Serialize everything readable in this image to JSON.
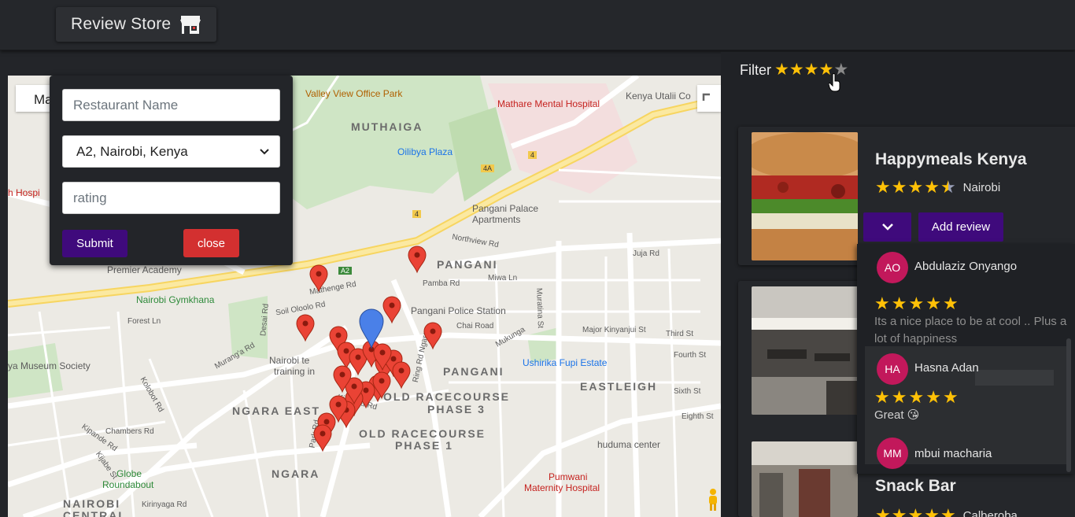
{
  "app": {
    "brand": "Review Store",
    "brand_icon": "store-icon"
  },
  "map": {
    "type_button": "Ma",
    "labels": {
      "valley": "Valley View Office Park",
      "mathare": "Mathare Mental Hospital",
      "kenya_utalii": "Kenya Utalii Co",
      "muthaiga": "MUTHAIGA",
      "oilibya": "Oilibya Plaza",
      "pangani_palace": "Pangani Palace",
      "pangani_palace2": "Apartments",
      "hosp_left": "h Hospi",
      "pangani": "PANGANI",
      "pangani2": "PANGANI",
      "premier": "Premier Academy",
      "gymkhana": "Nairobi Gymkhana",
      "police": "Pangani Police Station",
      "nairobi_tech": "Nairobi te",
      "nairobi_tech2": "training in",
      "ushirika": "Ushirika Fupi Estate",
      "eastleigh": "EASTLEIGH",
      "museum": "ya Museum Society",
      "ngara_east": "NGARA EAST",
      "old_race3": "OLD RACECOURSE",
      "phase3": "PHASE 3",
      "old_race1": "OLD RACECOURSE",
      "phase1": "PHASE 1",
      "huduma": "huduma center",
      "globe": "Globe",
      "roundabout": "Roundabout",
      "ngara": "NGARA",
      "pumwani": "Pumwani",
      "maternity": "Maternity Hospital",
      "nairobi_central": "NAIROBI",
      "nairobi_central2": "CENTRAL",
      "juja": "Juja Rd",
      "ring_rd": "Ring Rd Ngara",
      "muranga": "Murang'a Rd",
      "kipande": "Kipande Rd",
      "chambers": "Chambers Rd",
      "mathenge": "Mathenge Rd",
      "kinasha": "Kinasha Rd",
      "park_rd": "Park Rd",
      "forest": "Forest Ln",
      "desai": "Desai Rd",
      "pamba": "Pamba Rd",
      "miwa": "Miwa Ln",
      "chai": "Chai Road",
      "mukunga": "Mukunga",
      "major": "Major Kinyanjui St",
      "third_st": "Third St",
      "fourth_st": "Fourth St",
      "sixth_st": "Sixth St",
      "eighth_st": "Eighth St",
      "muratina": "Muratina St",
      "northview": "Northview Rd",
      "kolobot": "Kolobot Rd",
      "kijabe": "Kijabe St",
      "kirinyaga": "Kirinyaga Rd",
      "soil": "Soil Oloolo Rd",
      "road_a2": "A2",
      "road_4a": "4A",
      "road_4": "4"
    }
  },
  "form": {
    "name_placeholder": "Restaurant Name",
    "location_value": "A2, Nairobi, Kenya",
    "rating_placeholder": "rating",
    "submit_label": "Submit",
    "close_label": "close"
  },
  "filter": {
    "label": "Filter",
    "rating": 4,
    "max": 5
  },
  "restaurants": [
    {
      "name": "Happymeals Kenya",
      "city": "Nairobi",
      "rating": 4.5,
      "add_review_label": "Add review"
    },
    {
      "name": "Snack Bar",
      "city": "Calberoba",
      "rating": 5
    }
  ],
  "reviews": [
    {
      "initials": "AO",
      "name": "Abdulaziz Onyango",
      "rating": 5,
      "text": "Its a nice place to be at cool .. Plus a lot of happiness"
    },
    {
      "initials": "HA",
      "name": "Hasna Adan",
      "rating": 5,
      "text": "Great 😘"
    },
    {
      "initials": "MM",
      "name": "mbui macharia",
      "rating": 5,
      "text": ""
    }
  ],
  "colors": {
    "accent_purple": "#3f0a7c",
    "close_red": "#d33030",
    "star_gold": "#ffc107",
    "avatar_pink": "#c2185b",
    "pin_red": "#ea4335",
    "pin_blue": "#4a80e8"
  }
}
